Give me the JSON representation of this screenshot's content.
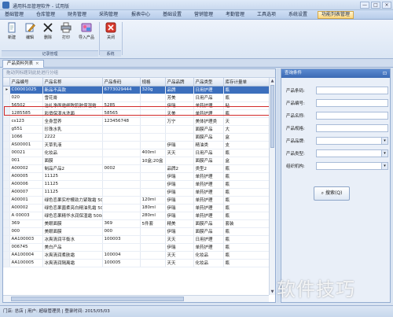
{
  "window": {
    "title": "通用料品管理软件 - 试用版",
    "controls": [
      "—",
      "□",
      "×"
    ]
  },
  "menubar": {
    "items": [
      "基础管理",
      "仓库管理",
      "财务管理",
      "采购管理",
      "报表中心",
      "基础设置",
      "营销管理",
      "考勤管理",
      "工具选项",
      "系统设置",
      "功能列表管理"
    ],
    "active_index": 10
  },
  "ribbon": {
    "buttons": [
      {
        "label": "新建",
        "icon": "new-document-icon"
      },
      {
        "label": "编辑",
        "icon": "edit-pencil-icon"
      },
      {
        "label": "删除",
        "icon": "delete-x-icon"
      },
      {
        "label": "打印",
        "icon": "printer-icon"
      },
      {
        "label": "导入产品",
        "icon": "import-icon"
      },
      {
        "label": "关闭",
        "icon": "close-red-icon"
      }
    ],
    "groups": [
      "记录管理",
      "系统"
    ]
  },
  "doc_tab": {
    "label": "产品资料列表",
    "close": "×"
  },
  "grid": {
    "group_hint": "拖动列标题到此处进行分组",
    "columns": [
      "产品编号",
      "产品名称",
      "产品条码",
      "规格",
      "产品品牌",
      "产品类型",
      "库存计量单"
    ],
    "rows": [
      [
        "C00001025",
        "新品不高款",
        "6773029444",
        "320g",
        "品牌",
        "日用护理",
        "瓶"
      ],
      [
        "020",
        "雪花膏",
        "",
        "",
        "芳美",
        "日用产品",
        "瓶"
      ],
      [
        "56502",
        "洁礼净面霜细致肌肤保湿霜",
        "5285",
        "",
        "伊瑞",
        "单药护理",
        "粘"
      ],
      [
        "1285585",
        "彩俏保湿水洗面",
        "58565",
        "",
        "天美",
        "单药护理",
        "瓶"
      ],
      [
        "cs123",
        "全身营养",
        "123456748",
        "",
        "万宁",
        "美体护理类",
        "天"
      ],
      [
        "g551",
        "珍珠水乳",
        "",
        "",
        "",
        "面膜产品",
        "大"
      ],
      [
        "1066",
        "2222",
        "",
        "",
        "",
        "面膜产品",
        "盒"
      ],
      [
        "AS00001",
        "天草乳液",
        "",
        "",
        "伊瑞",
        "精油类",
        "支"
      ],
      [
        "00021",
        "化妆品",
        "",
        "400ml",
        "天天",
        "日用产品",
        "瓶"
      ],
      [
        "001",
        "面膜",
        "",
        "10盒;20盒",
        "",
        "面膜产品",
        "盒"
      ],
      [
        "A00002",
        "制品产品2",
        "0002",
        "",
        "品牌2",
        "类型2",
        "瓶"
      ],
      [
        "A00005",
        "11125",
        "",
        "",
        "伊瑞",
        "单药护理",
        "瓶"
      ],
      [
        "A00006",
        "11125",
        "",
        "",
        "伊瑞",
        "单药护理",
        "瓶"
      ],
      [
        "A00007",
        "11125",
        "",
        "",
        "伊瑞",
        "单药护理",
        "瓶"
      ],
      [
        "A00001",
        "绿色恋果实柠檬劲力紧致霜 500g",
        "",
        "120ml",
        "伊瑞",
        "单药护理",
        "瓶"
      ],
      [
        "A00002",
        "绿色恋果菌柔亮白精油乳霜 500g",
        "",
        "180ml",
        "伊瑞",
        "单药护理",
        "瓶"
      ],
      [
        "A 00003",
        "绿色恋果精华水润保湿霜 500g",
        "",
        "280ml",
        "伊瑞",
        "单药护理",
        "瓶"
      ],
      [
        "369",
        "美眼面膜",
        "369",
        "5件套",
        "精美",
        "面膜产品",
        "套装"
      ],
      [
        "000",
        "美眼面膜",
        "000",
        "",
        "伊瑞",
        "面膜产品",
        "瓶"
      ],
      [
        "AA100003",
        "冰爽清润平衡水",
        "100003",
        "",
        "天天",
        "日用护理",
        "瓶"
      ],
      [
        "006745",
        "美白产品",
        "",
        "",
        "伊瑞",
        "单药护理",
        "瓶"
      ],
      [
        "AA100004",
        "冰爽清润柔肤霜",
        "100004",
        "",
        "天天",
        "化妆品",
        "瓶"
      ],
      [
        "AA100005",
        "冰爽清润隔离霜",
        "100005",
        "",
        "天天",
        "化妆品",
        "瓶"
      ]
    ]
  },
  "query": {
    "header": "查询条件",
    "fields": [
      {
        "label": "产品条码:",
        "value": "",
        "dropdown": false
      },
      {
        "label": "产品编号:",
        "value": "",
        "dropdown": false
      },
      {
        "label": "产品名称:",
        "value": "",
        "dropdown": false
      },
      {
        "label": "产品规格:",
        "value": "",
        "dropdown": false
      },
      {
        "label": "产品品牌:",
        "value": "",
        "dropdown": true
      },
      {
        "label": "产品类型:",
        "value": "",
        "dropdown": true
      },
      {
        "label": "组织机构:",
        "value": "",
        "dropdown": true
      }
    ],
    "button": "搜索(Q)"
  },
  "status": {
    "text": "门店: 总店 | 用户: 超级管理员 | 登录时间: 2015/05/03"
  },
  "watermark": "软件技巧"
}
